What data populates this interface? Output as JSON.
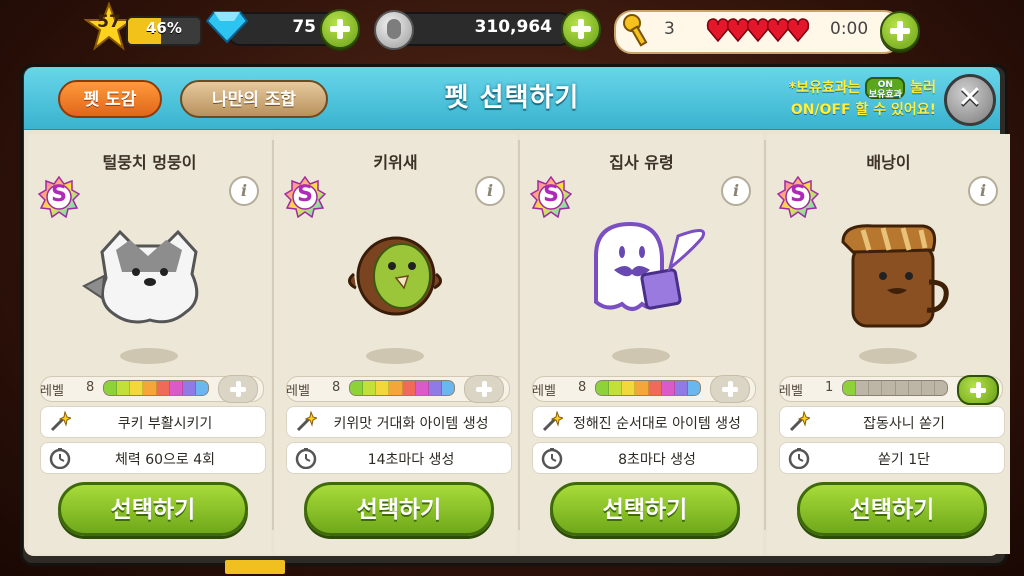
{
  "hud": {
    "level": "57",
    "xp_percent": "46%",
    "xp_fraction": 0.46,
    "gems": "75",
    "coins": "310,964",
    "keys": "3",
    "hearts_count": 5,
    "timer": "0:00"
  },
  "header": {
    "title": "펫 선택하기",
    "tab_dogam": "펫 도감",
    "tab_combo": "나만의 조합",
    "hint_line1_pre": "*보유효과는",
    "hint_badge_top": "ON",
    "hint_badge_bottom": "보유효과",
    "hint_line1_post": "눌러",
    "hint_line2": "ON/OFF 할 수 있어요!",
    "close": "✕"
  },
  "level_label": "레벨",
  "select_label": "선택하기",
  "info_glyph": "i",
  "s_glyph": "S",
  "pets": [
    {
      "name": "털뭉치 멍뭉이",
      "level": "8",
      "skill": "쿠키 부활시키기",
      "timing": "체력 60으로 4회",
      "level_fraction": 1.0
    },
    {
      "name": "키위새",
      "level": "8",
      "skill": "키위맛 거대화 아이템 생성",
      "timing": "14초마다 생성",
      "level_fraction": 1.0
    },
    {
      "name": "집사 유령",
      "level": "8",
      "skill": "정해진 순서대로 아이템 생성",
      "timing": "8초마다 생성",
      "level_fraction": 1.0
    },
    {
      "name": "배낭이",
      "level": "1",
      "skill": "잡동사니 쏟기",
      "timing": "쏟기 1단",
      "level_fraction": 0.125
    }
  ],
  "colors": {
    "header": "#3ab3cf",
    "select_button": "#6fa81a",
    "level_segments": [
      "#8ed23a",
      "#c3df3a",
      "#f2d83a",
      "#f5a63a",
      "#f06a5a",
      "#d95ac8",
      "#8f7ae6",
      "#6ab6ee"
    ]
  }
}
